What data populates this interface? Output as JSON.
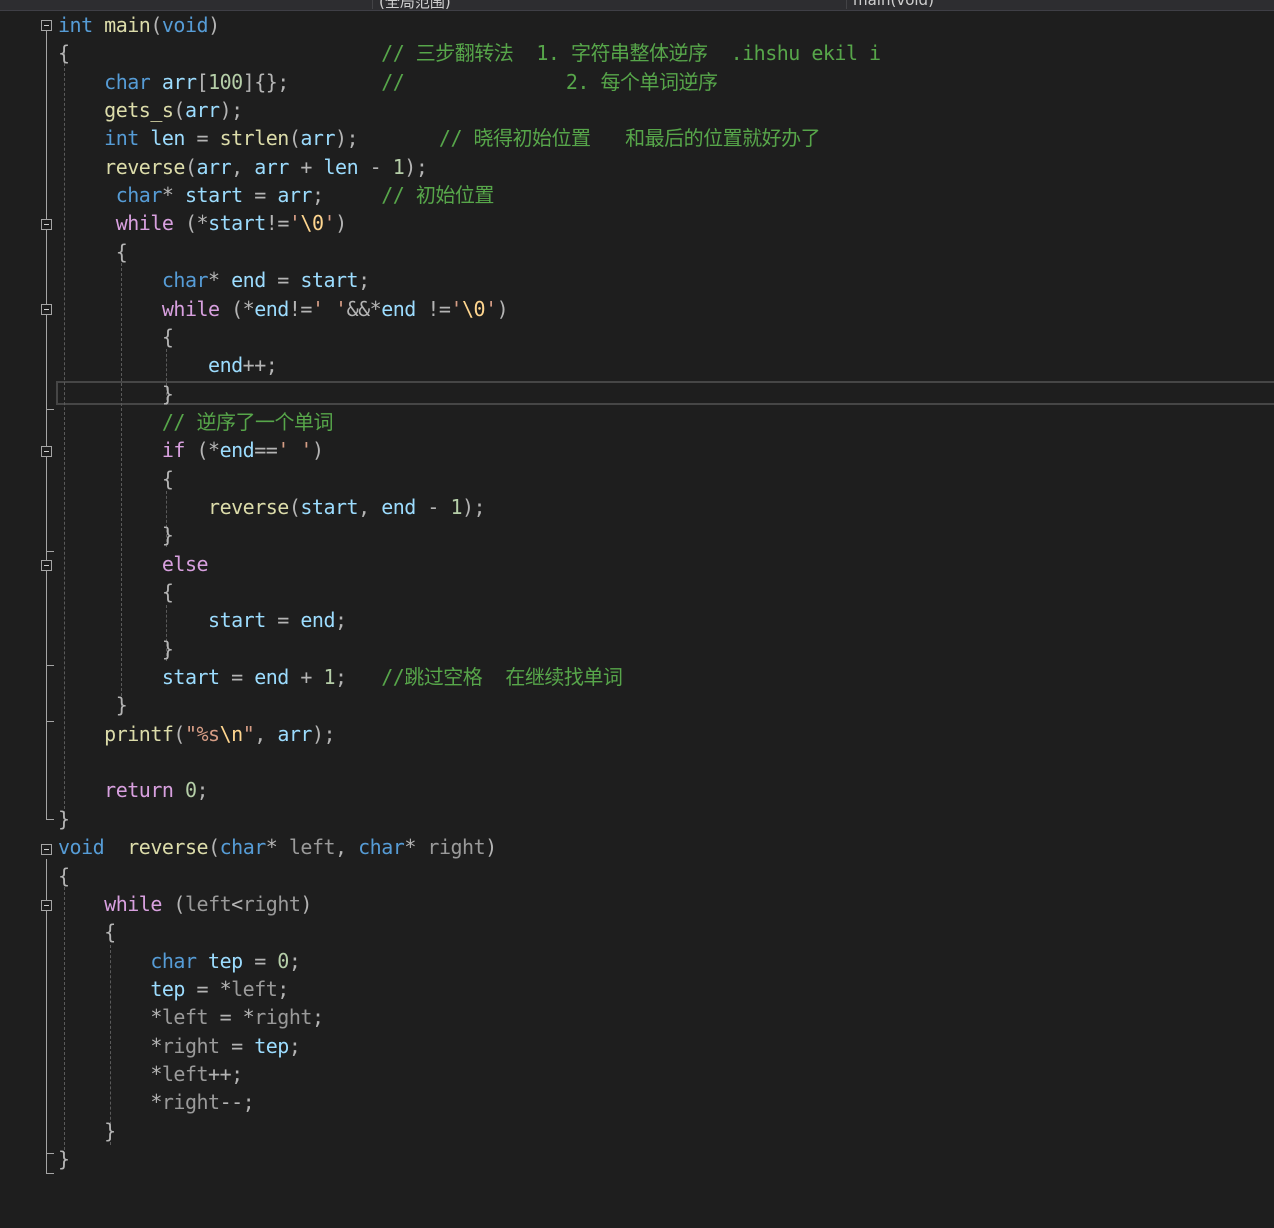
{
  "nav": {
    "project": "",
    "scope": "(全局范围)",
    "member": "main(void)"
  },
  "code_lines": [
    [
      [
        "kw",
        "int"
      ],
      [
        "punc",
        " "
      ],
      [
        "fn",
        "main"
      ],
      [
        "punc",
        "("
      ],
      [
        "kw",
        "void"
      ],
      [
        "punc",
        ")"
      ]
    ],
    [
      [
        "punc",
        "{"
      ],
      [
        "punc",
        "                           "
      ],
      [
        "cmt",
        "// 三步翻转法  1. 字符串整体逆序  .ihshu ekil i"
      ]
    ],
    [
      [
        "punc",
        "    "
      ],
      [
        "kw",
        "char"
      ],
      [
        "punc",
        " "
      ],
      [
        "var",
        "arr"
      ],
      [
        "punc",
        "["
      ],
      [
        "num",
        "100"
      ],
      [
        "punc",
        "]{};"
      ],
      [
        "punc",
        "        "
      ],
      [
        "cmt",
        "//              2. 每个单词逆序"
      ]
    ],
    [
      [
        "punc",
        "    "
      ],
      [
        "fn",
        "gets_s"
      ],
      [
        "punc",
        "("
      ],
      [
        "var",
        "arr"
      ],
      [
        "punc",
        ");"
      ]
    ],
    [
      [
        "punc",
        "    "
      ],
      [
        "kw",
        "int"
      ],
      [
        "punc",
        " "
      ],
      [
        "var",
        "len"
      ],
      [
        "punc",
        " = "
      ],
      [
        "fn",
        "strlen"
      ],
      [
        "punc",
        "("
      ],
      [
        "var",
        "arr"
      ],
      [
        "punc",
        ");"
      ],
      [
        "punc",
        "       "
      ],
      [
        "cmt",
        "// 晓得初始位置   和最后的位置就好办了"
      ]
    ],
    [
      [
        "punc",
        "    "
      ],
      [
        "fn",
        "reverse"
      ],
      [
        "punc",
        "("
      ],
      [
        "var",
        "arr"
      ],
      [
        "punc",
        ", "
      ],
      [
        "var",
        "arr"
      ],
      [
        "punc",
        " + "
      ],
      [
        "var",
        "len"
      ],
      [
        "punc",
        " - "
      ],
      [
        "num",
        "1"
      ],
      [
        "punc",
        ");"
      ]
    ],
    [
      [
        "punc",
        "     "
      ],
      [
        "kw",
        "char"
      ],
      [
        "punc",
        "* "
      ],
      [
        "var",
        "start"
      ],
      [
        "punc",
        " = "
      ],
      [
        "var",
        "arr"
      ],
      [
        "punc",
        ";"
      ],
      [
        "punc",
        "     "
      ],
      [
        "cmt",
        "// 初始位置"
      ]
    ],
    [
      [
        "punc",
        "     "
      ],
      [
        "ctl",
        "while"
      ],
      [
        "punc",
        " (*"
      ],
      [
        "var",
        "start"
      ],
      [
        "punc",
        "!="
      ],
      [
        "str",
        "'"
      ],
      [
        "esc",
        "\\0"
      ],
      [
        "str",
        "'"
      ],
      [
        "punc",
        ")"
      ]
    ],
    [
      [
        "punc",
        "     {"
      ]
    ],
    [
      [
        "punc",
        "         "
      ],
      [
        "kw",
        "char"
      ],
      [
        "punc",
        "* "
      ],
      [
        "var",
        "end"
      ],
      [
        "punc",
        " = "
      ],
      [
        "var",
        "start"
      ],
      [
        "punc",
        ";"
      ]
    ],
    [
      [
        "punc",
        "         "
      ],
      [
        "ctl",
        "while"
      ],
      [
        "punc",
        " (*"
      ],
      [
        "var",
        "end"
      ],
      [
        "punc",
        "!="
      ],
      [
        "str",
        "' '"
      ],
      [
        "punc",
        "&&*"
      ],
      [
        "var",
        "end"
      ],
      [
        "punc",
        " !="
      ],
      [
        "str",
        "'"
      ],
      [
        "esc",
        "\\0"
      ],
      [
        "str",
        "'"
      ],
      [
        "punc",
        ")"
      ]
    ],
    [
      [
        "punc",
        "         {"
      ]
    ],
    [
      [
        "punc",
        "             "
      ],
      [
        "var",
        "end"
      ],
      [
        "punc",
        "++;"
      ]
    ],
    [
      [
        "punc",
        "         }"
      ]
    ],
    [
      [
        "punc",
        "         "
      ],
      [
        "cmt",
        "// 逆序了一个单词"
      ]
    ],
    [
      [
        "punc",
        "         "
      ],
      [
        "ctl",
        "if"
      ],
      [
        "punc",
        " (*"
      ],
      [
        "var",
        "end"
      ],
      [
        "punc",
        "=="
      ],
      [
        "str",
        "' '"
      ],
      [
        "punc",
        ")"
      ]
    ],
    [
      [
        "punc",
        "         {"
      ]
    ],
    [
      [
        "punc",
        "             "
      ],
      [
        "fn",
        "reverse"
      ],
      [
        "punc",
        "("
      ],
      [
        "var",
        "start"
      ],
      [
        "punc",
        ", "
      ],
      [
        "var",
        "end"
      ],
      [
        "punc",
        " - "
      ],
      [
        "num",
        "1"
      ],
      [
        "punc",
        ");"
      ]
    ],
    [
      [
        "punc",
        "         }"
      ]
    ],
    [
      [
        "punc",
        "         "
      ],
      [
        "ctl",
        "else"
      ]
    ],
    [
      [
        "punc",
        "         {"
      ]
    ],
    [
      [
        "punc",
        "             "
      ],
      [
        "var",
        "start"
      ],
      [
        "punc",
        " = "
      ],
      [
        "var",
        "end"
      ],
      [
        "punc",
        ";"
      ]
    ],
    [
      [
        "punc",
        "         }"
      ]
    ],
    [
      [
        "punc",
        "         "
      ],
      [
        "var",
        "start"
      ],
      [
        "punc",
        " = "
      ],
      [
        "var",
        "end"
      ],
      [
        "punc",
        " + "
      ],
      [
        "num",
        "1"
      ],
      [
        "punc",
        ";"
      ],
      [
        "punc",
        "   "
      ],
      [
        "cmt",
        "//跳过空格  在继续找单词"
      ]
    ],
    [
      [
        "punc",
        "     }"
      ]
    ],
    [
      [
        "punc",
        "    "
      ],
      [
        "fn",
        "printf"
      ],
      [
        "punc",
        "("
      ],
      [
        "str",
        "\"%s"
      ],
      [
        "esc",
        "\\n"
      ],
      [
        "str",
        "\""
      ],
      [
        "punc",
        ", "
      ],
      [
        "var",
        "arr"
      ],
      [
        "punc",
        ");"
      ]
    ],
    [
      [
        "punc",
        ""
      ]
    ],
    [
      [
        "punc",
        "    "
      ],
      [
        "ctl",
        "return"
      ],
      [
        "punc",
        " "
      ],
      [
        "num",
        "0"
      ],
      [
        "punc",
        ";"
      ]
    ],
    [
      [
        "punc",
        "}"
      ]
    ],
    [
      [
        "kw",
        "void"
      ],
      [
        "punc",
        "  "
      ],
      [
        "fn",
        "reverse"
      ],
      [
        "punc",
        "("
      ],
      [
        "kw",
        "char"
      ],
      [
        "punc",
        "* "
      ],
      [
        "gray",
        "left"
      ],
      [
        "punc",
        ", "
      ],
      [
        "kw",
        "char"
      ],
      [
        "punc",
        "* "
      ],
      [
        "gray",
        "right"
      ],
      [
        "punc",
        ")"
      ]
    ],
    [
      [
        "punc",
        "{"
      ]
    ],
    [
      [
        "punc",
        "    "
      ],
      [
        "ctl",
        "while"
      ],
      [
        "punc",
        " ("
      ],
      [
        "gray",
        "left"
      ],
      [
        "punc",
        "<"
      ],
      [
        "gray",
        "right"
      ],
      [
        "punc",
        ")"
      ]
    ],
    [
      [
        "punc",
        "    {"
      ]
    ],
    [
      [
        "punc",
        "        "
      ],
      [
        "kw",
        "char"
      ],
      [
        "punc",
        " "
      ],
      [
        "var",
        "tep"
      ],
      [
        "punc",
        " = "
      ],
      [
        "num",
        "0"
      ],
      [
        "punc",
        ";"
      ]
    ],
    [
      [
        "punc",
        "        "
      ],
      [
        "var",
        "tep"
      ],
      [
        "punc",
        " = *"
      ],
      [
        "gray",
        "left"
      ],
      [
        "punc",
        ";"
      ]
    ],
    [
      [
        "punc",
        "        *"
      ],
      [
        "gray",
        "left"
      ],
      [
        "punc",
        " = *"
      ],
      [
        "gray",
        "right"
      ],
      [
        "punc",
        ";"
      ]
    ],
    [
      [
        "punc",
        "        *"
      ],
      [
        "gray",
        "right"
      ],
      [
        "punc",
        " = "
      ],
      [
        "var",
        "tep"
      ],
      [
        "punc",
        ";"
      ]
    ],
    [
      [
        "punc",
        "        *"
      ],
      [
        "gray",
        "left"
      ],
      [
        "punc",
        "++;"
      ]
    ],
    [
      [
        "punc",
        "        *"
      ],
      [
        "gray",
        "right"
      ],
      [
        "punc",
        "--;"
      ]
    ],
    [
      [
        "punc",
        "    }"
      ]
    ],
    [
      [
        "punc",
        "}"
      ]
    ]
  ]
}
